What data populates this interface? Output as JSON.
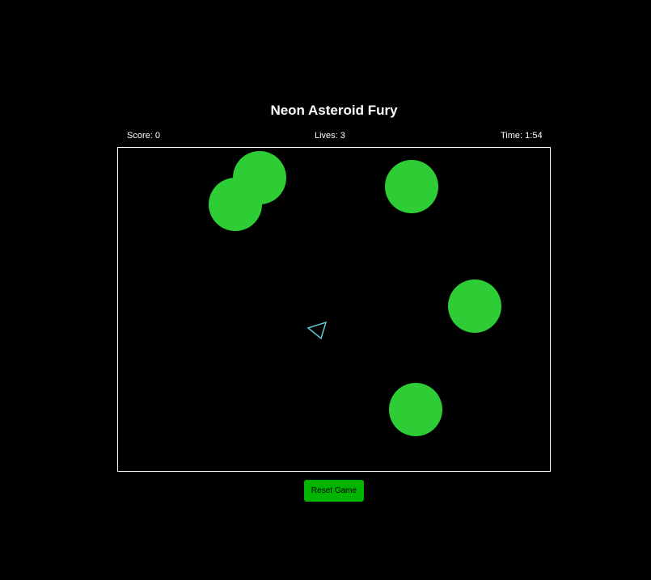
{
  "game": {
    "title": "Neon Asteroid Fury"
  },
  "hud": {
    "score_label": "Score: 0",
    "lives_label": "Lives: 3",
    "time_label": "Time: 1:54"
  },
  "controls": {
    "reset_label": "Reset Game"
  },
  "colors": {
    "background": "#000000",
    "asteroid": "#2ecc35",
    "ship": "#5fc8d0",
    "border": "#ffffff",
    "button": "#00b400"
  },
  "icons": {
    "ship": "triangle-ship-icon",
    "asteroid": "circle-asteroid-icon"
  }
}
